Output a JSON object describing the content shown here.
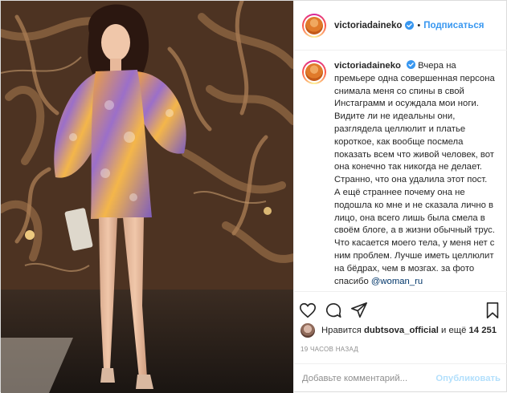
{
  "post": {
    "photo_alt": "",
    "header": {
      "username": "victoriadaineko",
      "separator": "•",
      "follow_label": "Подписаться"
    },
    "caption": {
      "username": "victoriadaineko",
      "text": "Вчера на премьере одна совершенная персона снимала меня со спины в свой Инстаграмм и осуждала мои ноги. Видите ли не идеальны они, разглядела целлюлит и платье короткое, как вообще посмела показать всем что живой человек, вот она конечно так никогда не делает. Странно, что она удалила этот пост. А ещё страннее почему она не подошла ко мне и не сказала лично в лицо, она всего лишь была смела в своём блоге, а в жизни обычный трус. Что касается моего тела, у меня нет с ним проблем. Лучше иметь целлюлит на бёдрах, чем в мозгах. за фото спасибо",
      "mention": "@woman_ru"
    },
    "actions": {
      "icons": [
        "heart-icon",
        "comment-icon",
        "share-icon",
        "bookmark-icon"
      ]
    },
    "likes": {
      "prefix": "Нравится",
      "user": "dubtsova_official",
      "middle": "и ещё",
      "count": "14 251"
    },
    "timestamp": "19 часов назад",
    "comment": {
      "placeholder": "Добавьте комментарий...",
      "post_label": "Опубликовать"
    },
    "colors": {
      "accent": "#3897f0",
      "post_disabled": "#b2dffc",
      "muted": "#8e8e8e",
      "mention": "#003569"
    }
  }
}
